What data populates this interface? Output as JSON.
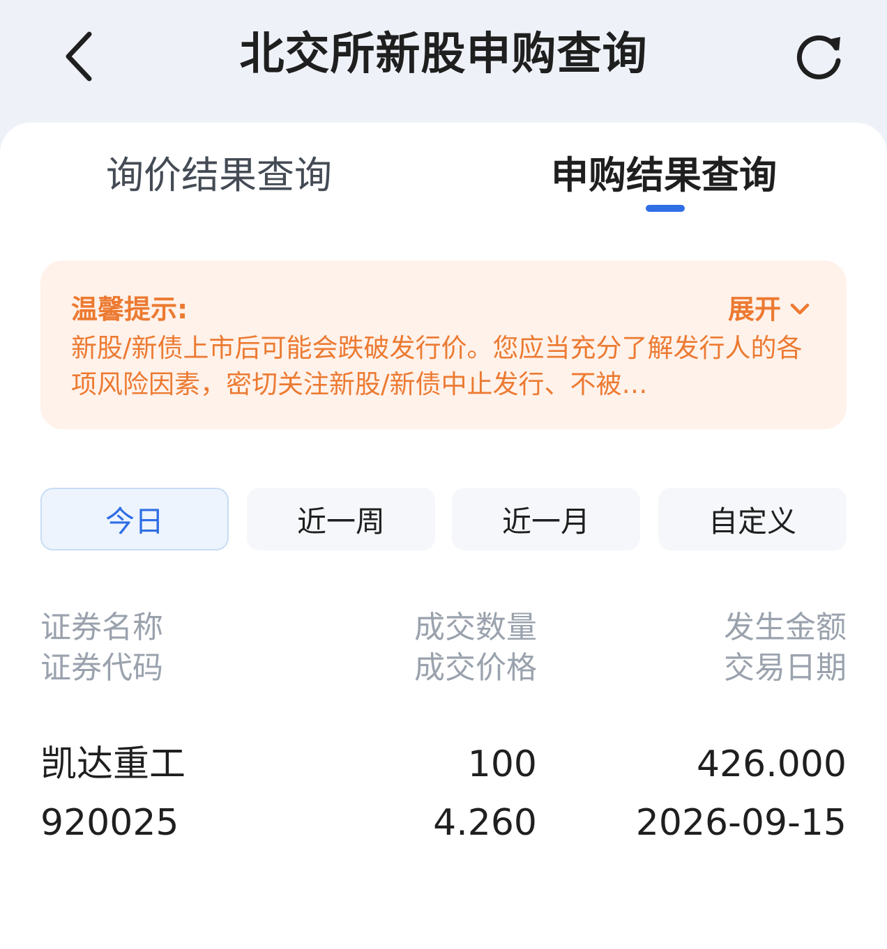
{
  "header": {
    "title": "北交所新股申购查询",
    "back_icon": "chevron-left-icon",
    "refresh_icon": "refresh-icon"
  },
  "tabs": [
    {
      "label": "询价结果查询",
      "active": false
    },
    {
      "label": "申购结果查询",
      "active": true
    }
  ],
  "notice": {
    "title": "温馨提示:",
    "expand_label": "展开",
    "body": "新股/新债上市后可能会跌破发行价。您应当充分了解发行人的各项风险因素，密切关注新股/新债中止发行、不被…"
  },
  "filters": [
    {
      "label": "今日",
      "active": true
    },
    {
      "label": "近一周",
      "active": false
    },
    {
      "label": "近一月",
      "active": false
    },
    {
      "label": "自定义",
      "active": false
    }
  ],
  "table": {
    "headers": {
      "col1_line1": "证券名称",
      "col1_line2": "证券代码",
      "col2_line1": "成交数量",
      "col2_line2": "成交价格",
      "col3_line1": "发生金额",
      "col3_line2": "交易日期"
    },
    "rows": [
      {
        "name": "凯达重工",
        "code": "920025",
        "quantity": "100",
        "price": "4.260",
        "amount": "426.000",
        "date": "2026-09-15"
      }
    ]
  },
  "colors": {
    "accent": "#2f6ee5",
    "notice_text": "#ec7a32",
    "notice_bg": "#fff2ea"
  }
}
